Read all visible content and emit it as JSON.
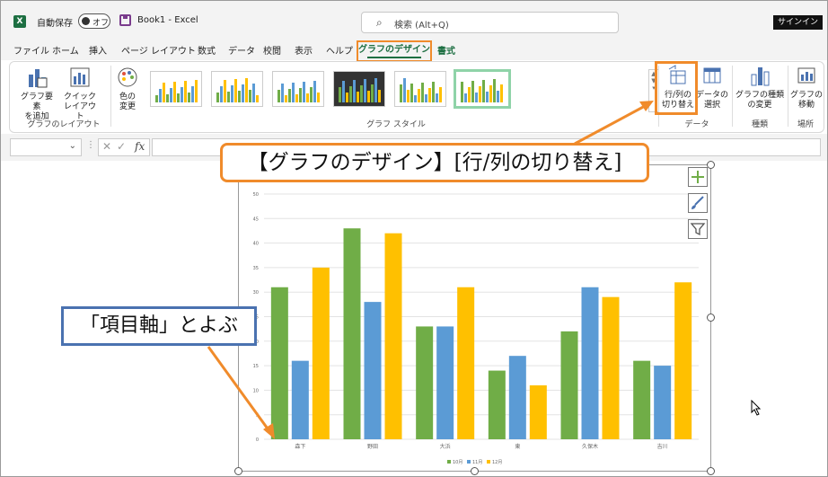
{
  "titlebar": {
    "logo": "X",
    "autosave_label": "自動保存",
    "autosave_state": "オフ",
    "document_title": "Book1  -  Excel",
    "search_placeholder": "検索 (Alt+Q)",
    "signin_label": "サインイン"
  },
  "tabs": [
    "ファイル",
    "ホーム",
    "挿入",
    "ページ レイアウト",
    "数式",
    "データ",
    "校閲",
    "表示",
    "ヘルプ",
    "グラフのデザイン",
    "書式"
  ],
  "ribbon": {
    "add_element": [
      "グラフ要素",
      "を追加"
    ],
    "quick_layout": [
      "クイック",
      "レイアウト"
    ],
    "change_color": [
      "色の",
      "変更"
    ],
    "group_layout": "グラフのレイアウト",
    "group_styles": "グラフ スタイル",
    "switch_row_col": [
      "行/列の",
      "切り替え"
    ],
    "select_data": [
      "データの",
      "選択"
    ],
    "group_data": "データ",
    "change_type": [
      "グラフの種類",
      "の変更"
    ],
    "group_type": "種類",
    "move_chart": [
      "グラフの",
      "移動"
    ],
    "group_location": "場所"
  },
  "formula_bar": {
    "fx": "fx"
  },
  "callouts": {
    "orange": "【グラフのデザイン】[行/列の切り替え]",
    "blue": "「項目軸」とよぶ"
  },
  "colors": {
    "green": "#70ad47",
    "blue": "#5b9bd5",
    "yellow": "#ffc000",
    "orange_accent": "#f08b2b",
    "callout_blue": "#4a72b0"
  },
  "chart_data": {
    "type": "bar",
    "categories": [
      "森下",
      "野田",
      "大浜",
      "東",
      "久保木",
      "吉川"
    ],
    "series": [
      {
        "name": "10月",
        "values": [
          31,
          43,
          23,
          14,
          22,
          16
        ]
      },
      {
        "name": "11月",
        "values": [
          16,
          28,
          23,
          17,
          31,
          15
        ]
      },
      {
        "name": "12月",
        "values": [
          35,
          42,
          31,
          11,
          29,
          32
        ]
      }
    ],
    "yticks": [
      0,
      5,
      10,
      15,
      20,
      25,
      30,
      35,
      40,
      45,
      50
    ],
    "ylim": [
      0,
      50
    ],
    "grid": true,
    "legend": "bottom"
  }
}
